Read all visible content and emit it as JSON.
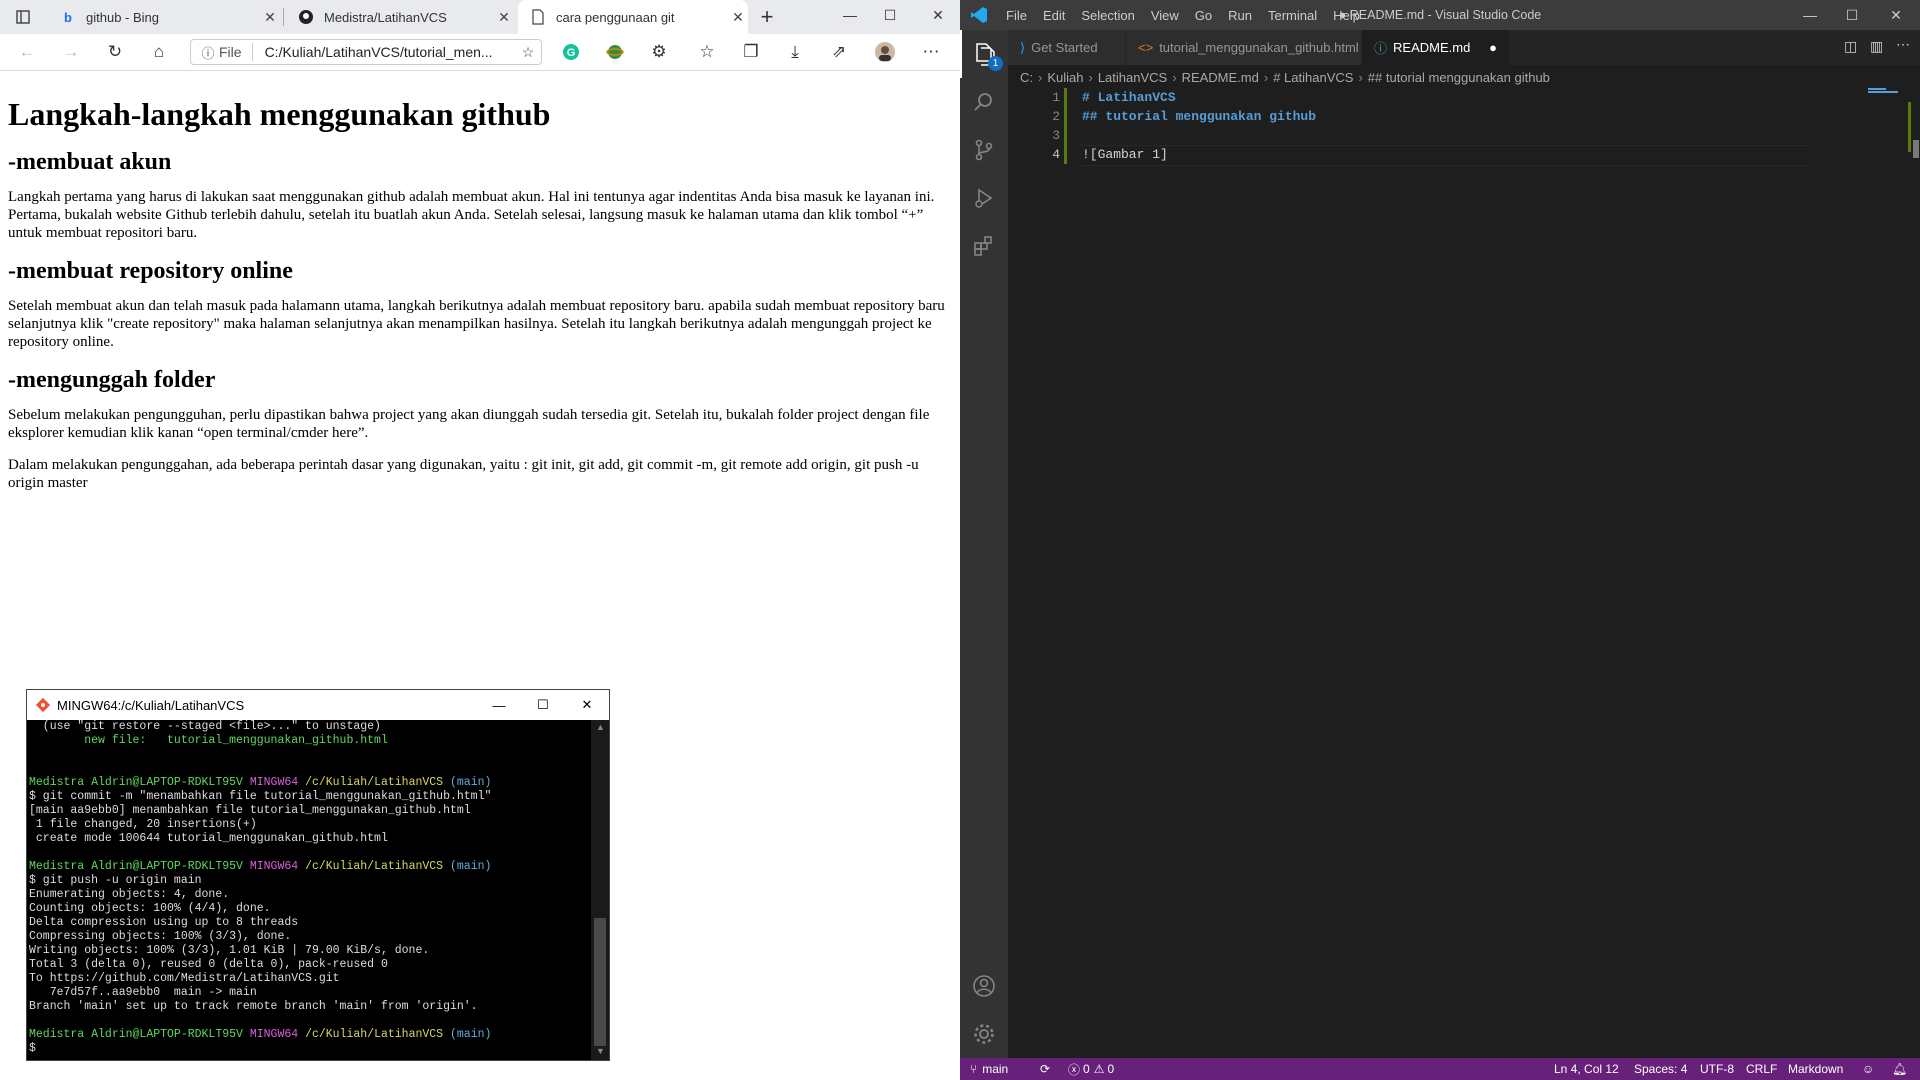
{
  "browser": {
    "tabs": [
      {
        "label": "github - Bing",
        "icon": "bing-icon"
      },
      {
        "label": "Medistra/LatihanVCS",
        "icon": "github-icon"
      },
      {
        "label": "cara penggunaan git",
        "icon": "page-icon"
      }
    ],
    "address": {
      "scheme": "File",
      "url": "C:/Kuliah/LatihanVCS/tutorial_men..."
    },
    "page": {
      "h1": "Langkah-langkah menggunakan github",
      "sections": [
        {
          "heading": "-membuat akun",
          "paragraphs": [
            "Langkah pertama yang harus di lakukan saat menggunakan github adalah membuat akun. Hal ini tentunya agar indentitas Anda bisa masuk ke layanan ini. Pertama, bukalah website Github terlebih dahulu, setelah itu buatlah akun Anda. Setelah selesai, langsung masuk ke halaman utama dan klik tombol “+” untuk membuat repositori baru."
          ]
        },
        {
          "heading": "-membuat repository online",
          "paragraphs": [
            "Setelah membuat akun dan telah masuk pada halamann utama, langkah berikutnya adalah membuat repository baru. apabila sudah membuat repository baru selanjutnya klik \"create repository\" maka halaman selanjutnya akan menampilkan hasilnya. Setelah itu langkah berikutnya adalah mengunggah project ke repository online."
          ]
        },
        {
          "heading": "-mengunggah folder",
          "paragraphs": [
            "Sebelum melakukan pengungguhan, perlu dipastikan bahwa project yang akan diunggah sudah tersedia git. Setelah itu, bukalah folder project dengan file eksplorer kemudian klik kanan “open terminal/cmder here”.",
            "Dalam melakukan pengunggahan, ada beberapa perintah dasar yang digunakan, yaitu : git init, git add, git commit -m, git remote add origin, git push -u origin master"
          ]
        }
      ]
    }
  },
  "terminal": {
    "title": "MINGW64:/c/Kuliah/LatihanVCS",
    "prompt": {
      "user": "Medistra Aldrin@LAPTOP-RDKLT95V",
      "shell": "MINGW64",
      "path": "/c/Kuliah/LatihanVCS",
      "branch": "(main)"
    },
    "lines": [
      {
        "t": "  (use \"git restore --staged <file>...\" to unstage)",
        "c": "white"
      },
      {
        "t": "        new file:   tutorial_menggunakan_github.html",
        "c": "green"
      },
      {
        "t": "",
        "c": "white"
      },
      {
        "t": "",
        "c": "white"
      },
      {
        "t": "PROMPT",
        "c": "prompt"
      },
      {
        "t": "$ git commit -m \"menambahkan file tutorial_menggunakan_github.html\"",
        "c": "white"
      },
      {
        "t": "[main aa9ebb0] menambahkan file tutorial_menggunakan_github.html",
        "c": "white"
      },
      {
        "t": " 1 file changed, 20 insertions(+)",
        "c": "white"
      },
      {
        "t": " create mode 100644 tutorial_menggunakan_github.html",
        "c": "white"
      },
      {
        "t": "",
        "c": "white"
      },
      {
        "t": "PROMPT",
        "c": "prompt"
      },
      {
        "t": "$ git push -u origin main",
        "c": "white"
      },
      {
        "t": "Enumerating objects: 4, done.",
        "c": "white"
      },
      {
        "t": "Counting objects: 100% (4/4), done.",
        "c": "white"
      },
      {
        "t": "Delta compression using up to 8 threads",
        "c": "white"
      },
      {
        "t": "Compressing objects: 100% (3/3), done.",
        "c": "white"
      },
      {
        "t": "Writing objects: 100% (3/3), 1.01 KiB | 79.00 KiB/s, done.",
        "c": "white"
      },
      {
        "t": "Total 3 (delta 0), reused 0 (delta 0), pack-reused 0",
        "c": "white"
      },
      {
        "t": "To https://github.com/Medistra/LatihanVCS.git",
        "c": "white"
      },
      {
        "t": "   7e7d57f..aa9ebb0  main -> main",
        "c": "white"
      },
      {
        "t": "Branch 'main' set up to track remote branch 'main' from 'origin'.",
        "c": "white"
      },
      {
        "t": "",
        "c": "white"
      },
      {
        "t": "PROMPT",
        "c": "prompt"
      },
      {
        "t": "$",
        "c": "white"
      }
    ]
  },
  "vscode": {
    "menu": [
      "File",
      "Edit",
      "Selection",
      "View",
      "Go",
      "Run",
      "Terminal",
      "Help"
    ],
    "window_title": "● README.md - Visual Studio Code",
    "tabs": [
      {
        "label": "Get Started",
        "icon": "vscode-icon"
      },
      {
        "label": "tutorial_menggunakan_github.html",
        "icon": "html-icon"
      },
      {
        "label": "README.md",
        "icon": "info-icon",
        "modified": "●"
      }
    ],
    "breadcrumb": [
      "C:",
      "Kuliah",
      "LatihanVCS",
      "README.md",
      "# LatihanVCS",
      "## tutorial menggunakan github"
    ],
    "explorer_badge": "1",
    "code": [
      {
        "n": "1",
        "text": "# LatihanVCS",
        "color": "#569cd6"
      },
      {
        "n": "2",
        "text": "## tutorial menggunakan github",
        "color": "#569cd6"
      },
      {
        "n": "3",
        "text": "",
        "color": "#d4d4d4"
      },
      {
        "n": "4",
        "text": "![Gambar 1]",
        "color": "#d4d4d4"
      }
    ],
    "status": {
      "branch": "main",
      "errors": "0",
      "warnings": "0",
      "position": "Ln 4, Col 12",
      "spaces": "Spaces: 4",
      "encoding": "UTF-8",
      "eol": "CRLF",
      "language": "Markdown"
    }
  },
  "colors": {
    "statusbar": "#68217a",
    "vscode_bg": "#1e1e1e",
    "activitybar": "#333333"
  }
}
